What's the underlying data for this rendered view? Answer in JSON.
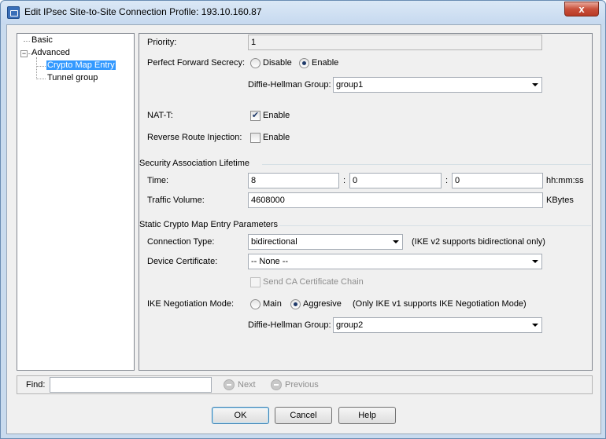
{
  "window": {
    "title": "Edit IPsec Site-to-Site Connection Profile: 193.10.160.87",
    "close_label": "x"
  },
  "tree": {
    "basic": "Basic",
    "advanced": "Advanced",
    "crypto_map_entry": "Crypto Map Entry",
    "tunnel_group": "Tunnel group",
    "collapse_symbol": "−"
  },
  "form": {
    "priority_label": "Priority:",
    "priority_value": "1",
    "pfs_label": "Perfect Forward Secrecy:",
    "pfs_disable": "Disable",
    "pfs_enable": "Enable",
    "pfs_selected": "Enable",
    "dh_group_label": "Diffie-Hellman Group:",
    "dh_group_value": "group1",
    "natt_label": "NAT-T:",
    "natt_enable": "Enable",
    "natt_checked": true,
    "rri_label": "Reverse Route Injection:",
    "rri_enable": "Enable",
    "rri_checked": false
  },
  "sa_lifetime": {
    "section_title": "Security Association Lifetime",
    "time_label": "Time:",
    "hours": "8",
    "minutes": "0",
    "seconds": "0",
    "sep1": ":",
    "sep2": ":",
    "time_unit": "hh:mm:ss",
    "traffic_label": "Traffic Volume:",
    "traffic_value": "4608000",
    "traffic_unit": "KBytes"
  },
  "static_crypto": {
    "section_title": "Static Crypto Map Entry Parameters",
    "conn_type_label": "Connection Type:",
    "conn_type_value": "bidirectional",
    "conn_type_note": "(IKE v2 supports bidirectional only)",
    "device_cert_label": "Device Certificate:",
    "device_cert_value": "-- None --",
    "send_ca_label": "Send CA Certificate Chain",
    "ike_mode_label": "IKE Negotiation Mode:",
    "ike_main": "Main",
    "ike_aggressive": "Aggresive",
    "ike_selected": "Aggresive",
    "ike_note": "(Only IKE v1 supports IKE Negotiation Mode)",
    "dh_group_label": "Diffie-Hellman Group:",
    "dh_group_value": "group2"
  },
  "findbar": {
    "find_label": "Find:",
    "find_value": "",
    "next_label": "Next",
    "previous_label": "Previous"
  },
  "buttons": {
    "ok": "OK",
    "cancel": "Cancel",
    "help": "Help"
  }
}
